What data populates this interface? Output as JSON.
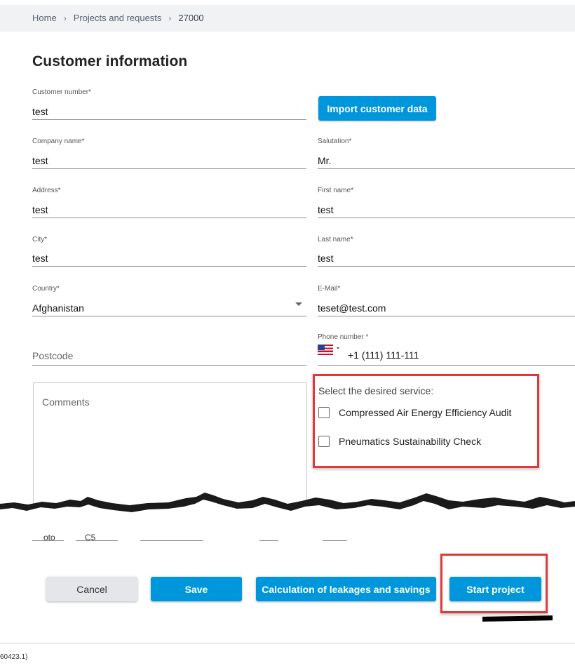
{
  "breadcrumb": {
    "home": "Home",
    "projects": "Projects and requests",
    "current": "27000",
    "separator": "›"
  },
  "page_title": "Customer information",
  "form": {
    "customer_number": {
      "label": "Customer number*",
      "value": "test"
    },
    "import_button": "Import customer data",
    "company_name": {
      "label": "Company name*",
      "value": "test"
    },
    "salutation": {
      "label": "Salutation*",
      "value": "Mr."
    },
    "address": {
      "label": "Address*",
      "value": "test"
    },
    "first_name": {
      "label": "First name*",
      "value": "test"
    },
    "city": {
      "label": "City*",
      "value": "test"
    },
    "last_name": {
      "label": "Last name*",
      "value": "test"
    },
    "country": {
      "label": "Country*",
      "value": "Afghanistan"
    },
    "email": {
      "label": "E-Mail*",
      "value": "teset@test.com"
    },
    "phone": {
      "label": "Phone number *",
      "value": "+1 (111) 111-111",
      "flag": "us-flag-icon"
    },
    "postcode": {
      "placeholder": "Postcode"
    },
    "comments": {
      "placeholder": "Comments"
    }
  },
  "services": {
    "title": "Select the desired service:",
    "options": [
      {
        "label": "Compressed Air Energy Efficiency Audit",
        "checked": false
      },
      {
        "label": "Pneumatics Sustainability Check",
        "checked": false
      }
    ]
  },
  "partial_fields": [
    "oto",
    "C5"
  ],
  "buttons": {
    "cancel": "Cancel",
    "save": "Save",
    "calc": "Calculation of leakages and savings",
    "start": "Start project"
  },
  "version": "60423.1)",
  "colors": {
    "primary": "#0096dc",
    "highlight": "#e0393b",
    "secondary_button": "#e4e6e9"
  }
}
